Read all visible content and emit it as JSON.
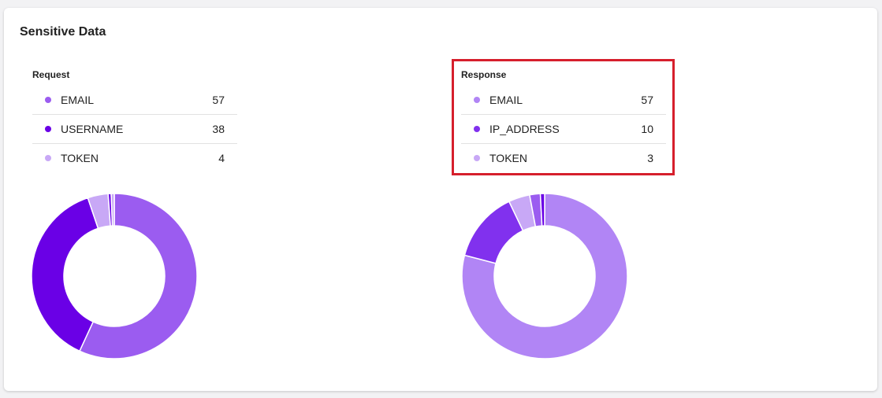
{
  "card": {
    "title": "Sensitive Data"
  },
  "request": {
    "title": "Request",
    "items": [
      {
        "label": "EMAIL",
        "count": "57",
        "value": 57,
        "color": "#9b5cf0"
      },
      {
        "label": "USERNAME",
        "count": "38",
        "value": 38,
        "color": "#6a00e6"
      },
      {
        "label": "TOKEN",
        "count": "4",
        "value": 4,
        "color": "#c8a8f6"
      }
    ],
    "chart_extra_slices": [
      {
        "value": 0.6,
        "color": "#6a00e6"
      },
      {
        "value": 0.6,
        "color": "#c8a8f6"
      }
    ]
  },
  "response": {
    "title": "Response",
    "items": [
      {
        "label": "EMAIL",
        "count": "57",
        "value": 57,
        "color": "#b185f5"
      },
      {
        "label": "IP_ADDRESS",
        "count": "10",
        "value": 10,
        "color": "#8131ee"
      },
      {
        "label": "TOKEN",
        "count": "3",
        "value": 3,
        "color": "#c8a8f6"
      }
    ],
    "chart_extra_slices": [
      {
        "value": 1.5,
        "color": "#9b5cf0"
      },
      {
        "value": 0.6,
        "color": "#6a00e6"
      }
    ]
  },
  "chart_data": [
    {
      "type": "pie",
      "name": "Request",
      "categories": [
        "EMAIL",
        "USERNAME",
        "TOKEN"
      ],
      "values": [
        57,
        38,
        4
      ]
    },
    {
      "type": "pie",
      "name": "Response",
      "categories": [
        "EMAIL",
        "IP_ADDRESS",
        "TOKEN"
      ],
      "values": [
        57,
        10,
        3
      ]
    }
  ]
}
